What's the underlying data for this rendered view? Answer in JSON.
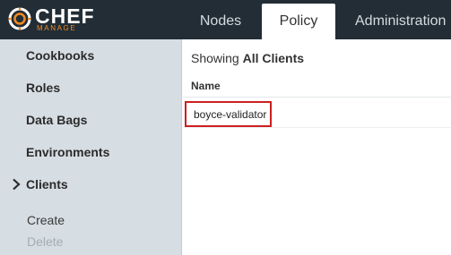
{
  "brand": {
    "name": "CHEF",
    "subtitle": "MANAGE",
    "logo_icon": "chef-logo-icon",
    "accent_color": "#f18b21"
  },
  "tabs": [
    {
      "label": "Nodes",
      "active": false
    },
    {
      "label": "Policy",
      "active": true
    },
    {
      "label": "Administration",
      "active": false
    }
  ],
  "sidebar": {
    "items": [
      {
        "label": "Cookbooks"
      },
      {
        "label": "Roles"
      },
      {
        "label": "Data Bags"
      },
      {
        "label": "Environments"
      },
      {
        "label": "Clients",
        "selected": true,
        "icon": "chevron-right-icon"
      }
    ],
    "actions": [
      {
        "label": "Create",
        "enabled": true
      },
      {
        "label": "Delete",
        "enabled": false
      }
    ]
  },
  "main": {
    "showing_prefix": "Showing",
    "showing_filter": "All Clients",
    "table": {
      "columns": [
        "Name"
      ],
      "rows": [
        {
          "name": "boyce-validator",
          "highlighted": true,
          "highlight_color": "#cc1f1f"
        }
      ]
    }
  }
}
